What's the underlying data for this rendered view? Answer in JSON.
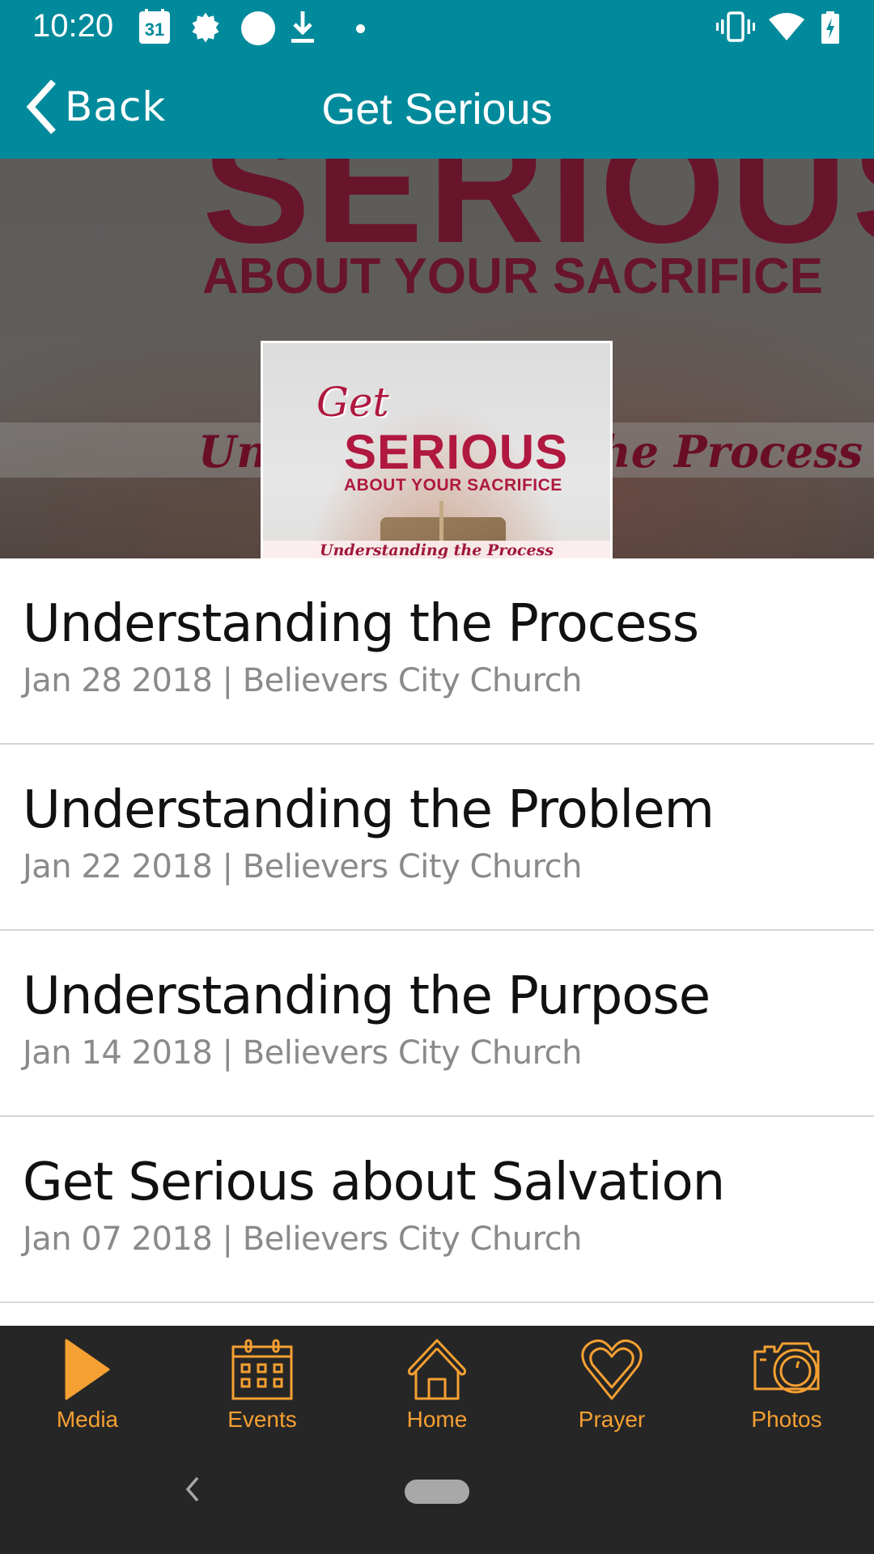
{
  "status_bar": {
    "time": "10:20",
    "calendar_day": "31",
    "left_icons": [
      "calendar-icon",
      "gear-icon",
      "circle-icon",
      "download-icon",
      "dot-icon"
    ],
    "right_icons": [
      "vibrate-icon",
      "wifi-icon",
      "battery-charging-icon"
    ]
  },
  "app_bar": {
    "back_label": "Back",
    "title": "Get Serious",
    "color": "#008a9b"
  },
  "hero": {
    "bg_text_big": "SERIOUS",
    "bg_text_mid": "ABOUT YOUR SACRIFICE",
    "bg_band_text": "Understanding the Process",
    "cover": {
      "get": "Get",
      "serious": "SERIOUS",
      "about": "ABOUT YOUR SACRIFICE",
      "subtitle": "Understanding the Process"
    }
  },
  "sermons": [
    {
      "title": "Understanding the Process",
      "meta": "Jan 28 2018 | Believers City Church"
    },
    {
      "title": "Understanding the Problem",
      "meta": "Jan 22 2018 | Believers City Church"
    },
    {
      "title": "Understanding the Purpose",
      "meta": "Jan 14 2018 | Believers City Church"
    },
    {
      "title": "Get Serious about Salvation",
      "meta": "Jan 07 2018 | Believers City Church"
    }
  ],
  "bottom_nav": {
    "accent_color": "#f5a032",
    "items": [
      {
        "label": "Media",
        "icon": "play-icon",
        "active": true
      },
      {
        "label": "Events",
        "icon": "calendar-icon"
      },
      {
        "label": "Home",
        "icon": "home-icon"
      },
      {
        "label": "Prayer",
        "icon": "heart-icon"
      },
      {
        "label": "Photos",
        "icon": "camera-icon"
      }
    ]
  }
}
